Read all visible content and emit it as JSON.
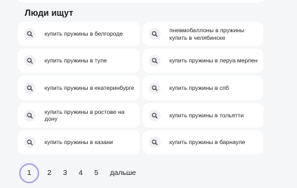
{
  "section": {
    "title": "Люди ищут"
  },
  "queries": [
    {
      "text": "купить пружины в белгороде",
      "icon": "search-icon"
    },
    {
      "text": "пневмобаллоны в пружины купить в челябинске",
      "icon": "search-icon"
    },
    {
      "text": "купить пружины в туле",
      "icon": "search-icon"
    },
    {
      "text": "купить пружины в леруа мерлен",
      "icon": "search-icon"
    },
    {
      "text": "купить пружины в екатеринбурге",
      "icon": "search-icon"
    },
    {
      "text": "купить пружины в спб",
      "icon": "search-icon"
    },
    {
      "text": "купить пружины в ростове на дону",
      "icon": "search-icon"
    },
    {
      "text": "купить пружины в тольятти",
      "icon": "search-icon"
    },
    {
      "text": "купить пружины в казани",
      "icon": "search-icon"
    },
    {
      "text": "купить пружины в барнауле",
      "icon": "search-icon"
    }
  ],
  "pagination": {
    "current": "1",
    "pages": [
      "2",
      "3",
      "4",
      "5"
    ],
    "next_label": "дальше"
  },
  "colors": {
    "background": "#f5f6f8",
    "card": "#ffffff",
    "icon_bg": "#eef0f5",
    "current_page_ring": "#a89be6"
  }
}
